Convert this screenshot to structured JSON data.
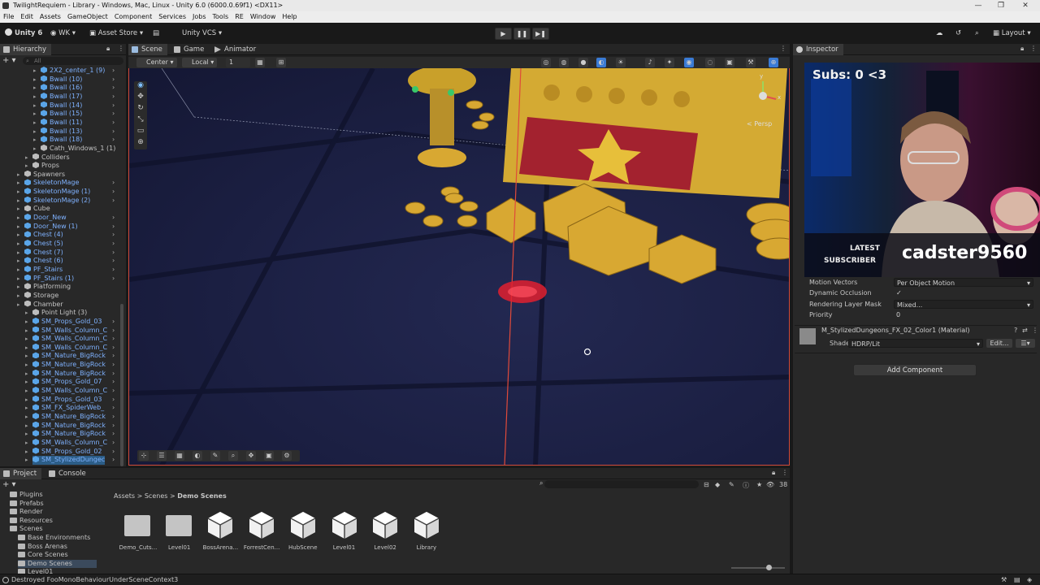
{
  "window": {
    "title": "TwilightRequiem - Library - Windows, Mac, Linux - Unity 6.0 (6000.0.69f1) <DX11>",
    "controls": [
      "—",
      "❐",
      "✕"
    ]
  },
  "menu": [
    "File",
    "Edit",
    "Assets",
    "GameObject",
    "Component",
    "Services",
    "Jobs",
    "Tools",
    "RE",
    "Window",
    "Help"
  ],
  "toolbar": {
    "unity_label": "Unity 6",
    "account_label": "WK",
    "asset_store_label": "Asset Store",
    "vcs_label": "Unity VCS",
    "layout_label": "Layout"
  },
  "hierarchy": {
    "tab_label": "Hierarchy",
    "search_placeholder": "All",
    "items": [
      {
        "label": "2X2_center_1 (9)",
        "style": "blue",
        "indent": 3,
        "more": true
      },
      {
        "label": "Bwall (10)",
        "style": "blue",
        "indent": 3,
        "more": true
      },
      {
        "label": "Bwall (16)",
        "style": "blue",
        "indent": 3,
        "more": true
      },
      {
        "label": "Bwall (17)",
        "style": "blue",
        "indent": 3,
        "more": true
      },
      {
        "label": "Bwall (14)",
        "style": "blue",
        "indent": 3,
        "more": true
      },
      {
        "label": "Bwall (15)",
        "style": "blue",
        "indent": 3,
        "more": true
      },
      {
        "label": "Bwall (11)",
        "style": "blue",
        "indent": 3,
        "more": true
      },
      {
        "label": "Bwall (13)",
        "style": "blue",
        "indent": 3,
        "more": true
      },
      {
        "label": "Bwall (18)",
        "style": "blue",
        "indent": 3,
        "more": true
      },
      {
        "label": "Cath_Windows_1 (1)",
        "style": "gray",
        "indent": 3,
        "more": false
      },
      {
        "label": "Colliders",
        "style": "gray",
        "indent": 2,
        "more": false
      },
      {
        "label": "Props",
        "style": "gray",
        "indent": 2,
        "more": false
      },
      {
        "label": "Spawners",
        "style": "gray",
        "indent": 1,
        "more": false
      },
      {
        "label": "SkeletonMage",
        "style": "blue",
        "indent": 1,
        "more": true
      },
      {
        "label": "SkeletonMage (1)",
        "style": "blue",
        "indent": 1,
        "more": true
      },
      {
        "label": "SkeletonMage (2)",
        "style": "blue",
        "indent": 1,
        "more": true
      },
      {
        "label": "Cube",
        "style": "gray",
        "indent": 1,
        "more": false
      },
      {
        "label": "Door_New",
        "style": "blue",
        "indent": 1,
        "more": true
      },
      {
        "label": "Door_New (1)",
        "style": "blue",
        "indent": 1,
        "more": true
      },
      {
        "label": "Chest (4)",
        "style": "blue",
        "indent": 1,
        "more": true
      },
      {
        "label": "Chest (5)",
        "style": "blue",
        "indent": 1,
        "more": true
      },
      {
        "label": "Chest (7)",
        "style": "blue",
        "indent": 1,
        "more": true
      },
      {
        "label": "Chest (6)",
        "style": "blue",
        "indent": 1,
        "more": true
      },
      {
        "label": "PF_Stairs",
        "style": "blue",
        "indent": 1,
        "more": true
      },
      {
        "label": "PF_Stairs (1)",
        "style": "blue",
        "indent": 1,
        "more": true
      },
      {
        "label": "Platforming",
        "style": "gray",
        "indent": 1,
        "more": false
      },
      {
        "label": "Storage",
        "style": "gray",
        "indent": 1,
        "more": false
      },
      {
        "label": "Chamber",
        "style": "gray",
        "indent": 1,
        "more": false
      },
      {
        "label": "Point Light (3)",
        "style": "gray",
        "indent": 2,
        "more": false
      },
      {
        "label": "SM_Props_Gold_03",
        "style": "blue",
        "indent": 2,
        "more": true
      },
      {
        "label": "SM_Walls_Column_C",
        "style": "blue",
        "indent": 2,
        "more": true
      },
      {
        "label": "SM_Walls_Column_C",
        "style": "blue",
        "indent": 2,
        "more": true
      },
      {
        "label": "SM_Walls_Column_C",
        "style": "blue",
        "indent": 2,
        "more": true
      },
      {
        "label": "SM_Nature_BigRock",
        "style": "blue",
        "indent": 2,
        "more": true
      },
      {
        "label": "SM_Nature_BigRock",
        "style": "blue",
        "indent": 2,
        "more": true
      },
      {
        "label": "SM_Nature_BigRock",
        "style": "blue",
        "indent": 2,
        "more": true
      },
      {
        "label": "SM_Props_Gold_07",
        "style": "blue",
        "indent": 2,
        "more": true
      },
      {
        "label": "SM_Walls_Column_C",
        "style": "blue",
        "indent": 2,
        "more": true
      },
      {
        "label": "SM_Props_Gold_03",
        "style": "blue",
        "indent": 2,
        "more": true
      },
      {
        "label": "SM_FX_SpiderWeb_",
        "style": "blue",
        "indent": 2,
        "more": true
      },
      {
        "label": "SM_Nature_BigRock",
        "style": "blue",
        "indent": 2,
        "more": true
      },
      {
        "label": "SM_Nature_BigRock",
        "style": "blue",
        "indent": 2,
        "more": true
      },
      {
        "label": "SM_Nature_BigRock",
        "style": "blue",
        "indent": 2,
        "more": true
      },
      {
        "label": "SM_Walls_Column_C",
        "style": "blue",
        "indent": 2,
        "more": true
      },
      {
        "label": "SM_Props_Gold_02",
        "style": "blue",
        "indent": 2,
        "more": true
      },
      {
        "label": "SM_StylizedDungec",
        "style": "blue-sel",
        "indent": 2,
        "more": true
      }
    ]
  },
  "scene": {
    "tabs": [
      "Scene",
      "Game",
      "Animator"
    ],
    "pivot_label": "Center",
    "space_label": "Local",
    "snap_value": "1",
    "persp_label": "< Persp",
    "gizmo_y": "y",
    "gizmo_x": "x"
  },
  "inspector": {
    "tab_label": "Inspector",
    "rows": [
      {
        "label": "Motion Vectors",
        "value": "Per Object Motion",
        "dropdown": true
      },
      {
        "label": "Dynamic Occlusion",
        "value": "✓",
        "dropdown": false
      },
      {
        "label": "Rendering Layer Mask",
        "value": "Mixed...",
        "dropdown": true
      },
      {
        "label": "Priority",
        "value": "0",
        "dropdown": false
      }
    ],
    "material_name": "M_StylizedDungeons_FX_02_Color1 (Material)",
    "shader_label": "Shader",
    "shader_value": "HDRP/Lit",
    "edit_label": "Edit...",
    "add_component_label": "Add Component"
  },
  "overlay": {
    "subs_text": "Subs: 0 <3",
    "latest_label": "LATEST",
    "subscriber_label": "SUBSCRIBER",
    "subscriber_name": "cadster9560"
  },
  "project": {
    "tabs": [
      "Project",
      "Console"
    ],
    "tree": [
      {
        "label": "Plugins",
        "indent": 1
      },
      {
        "label": "Prefabs",
        "indent": 1
      },
      {
        "label": "Render",
        "indent": 1
      },
      {
        "label": "Resources",
        "indent": 1
      },
      {
        "label": "Scenes",
        "indent": 1
      },
      {
        "label": "Base Environments",
        "indent": 2
      },
      {
        "label": "Boss Arenas",
        "indent": 2
      },
      {
        "label": "Core Scenes",
        "indent": 2
      },
      {
        "label": "Demo Scenes",
        "indent": 2
      },
      {
        "label": "Level01",
        "indent": 2
      }
    ],
    "breadcrumb": [
      "Assets",
      "Scenes",
      "Demo Scenes"
    ],
    "asset_count": "38",
    "assets": [
      {
        "label": "Demo_Cuts...",
        "kind": "folder"
      },
      {
        "label": "Level01",
        "kind": "folder"
      },
      {
        "label": "BossArena...",
        "kind": "scene"
      },
      {
        "label": "ForrestCen...",
        "kind": "scene"
      },
      {
        "label": "HubScene",
        "kind": "scene"
      },
      {
        "label": "Level01",
        "kind": "scene"
      },
      {
        "label": "Level02",
        "kind": "scene"
      },
      {
        "label": "Library",
        "kind": "scene"
      }
    ]
  },
  "status": {
    "message": "Destroyed FooMonoBehaviourUnderSceneContext3"
  },
  "colors": {
    "accent_blue": "#3a7bd5",
    "prefab_blue": "#7fb2ff",
    "selection_outline": "#d04a3a",
    "scene_bg": "#1b1f42",
    "gold": "#d8a832"
  }
}
